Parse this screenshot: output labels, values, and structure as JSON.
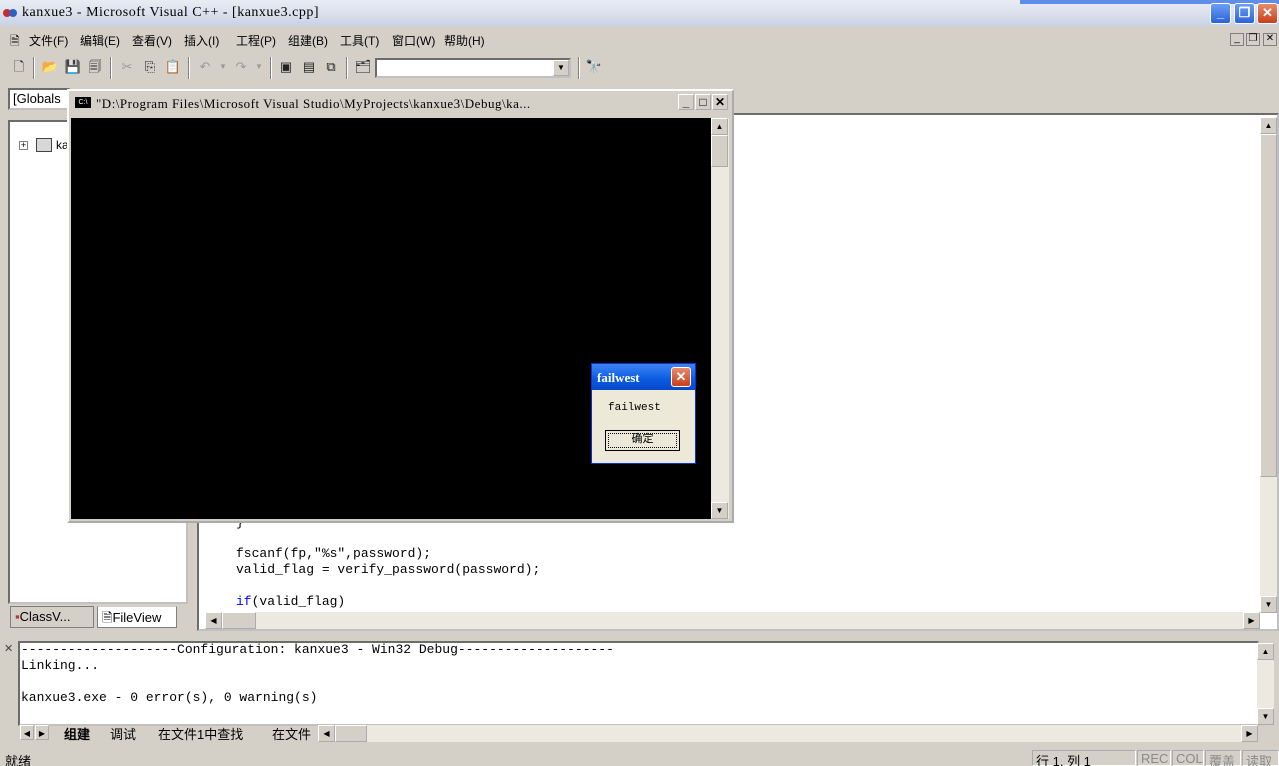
{
  "window": {
    "title": "kanxue3 - Microsoft Visual C++ - [kanxue3.cpp]",
    "controls": {
      "minimize": "_",
      "restore": "❐",
      "close": "✕"
    }
  },
  "menu": {
    "items": [
      "文件(F)",
      "编辑(E)",
      "查看(V)",
      "插入(I)",
      "工程(P)",
      "组建(B)",
      "工具(T)",
      "窗口(W)",
      "帮助(H)"
    ]
  },
  "toolbar": {
    "find_combo_value": "",
    "icons": [
      "new-file-icon",
      "open-icon",
      "save-icon",
      "save-all-icon",
      "cut-icon",
      "copy-icon",
      "paste-icon",
      "undo-icon",
      "redo-icon",
      "workspace-icon",
      "output-icon",
      "window-list-icon",
      "find-in-files-icon",
      "find-icon"
    ]
  },
  "class_combo": {
    "value": "[Globals"
  },
  "workspace": {
    "tree_root_label": "ka",
    "tabs": [
      "ClassV...",
      "FileView"
    ]
  },
  "editor": {
    "lines": [
      {
        "text": "fscanf(fp,\"%s\",password);"
      },
      {
        "text": "valid_flag = verify_password(password);"
      },
      {
        "kw": "if",
        "rest": "(valid_flag)"
      }
    ]
  },
  "output": {
    "lines": [
      "--------------------Configuration: kanxue3 - Win32 Debug--------------------",
      "Linking...",
      "",
      "kanxue3.exe - 0 error(s), 0 warning(s)"
    ],
    "tabs": [
      "组建",
      "调试",
      "在文件1中查找",
      "在文件"
    ]
  },
  "status": {
    "text": "就绪",
    "position": "行 1, 列 1",
    "indicators": [
      "REC",
      "COL",
      "覆盖",
      "读取"
    ]
  },
  "console": {
    "title": "\"D:\\Program Files\\Microsoft Visual Studio\\MyProjects\\kanxue3\\Debug\\ka...",
    "icon_text": "C:\\"
  },
  "msgbox": {
    "title": "failwest",
    "message": "failwest",
    "ok_label": "确定"
  },
  "colors": {
    "keyword": "#0000ff",
    "msgbox_title": "#0a5ae0",
    "console_bg": "#000000"
  }
}
